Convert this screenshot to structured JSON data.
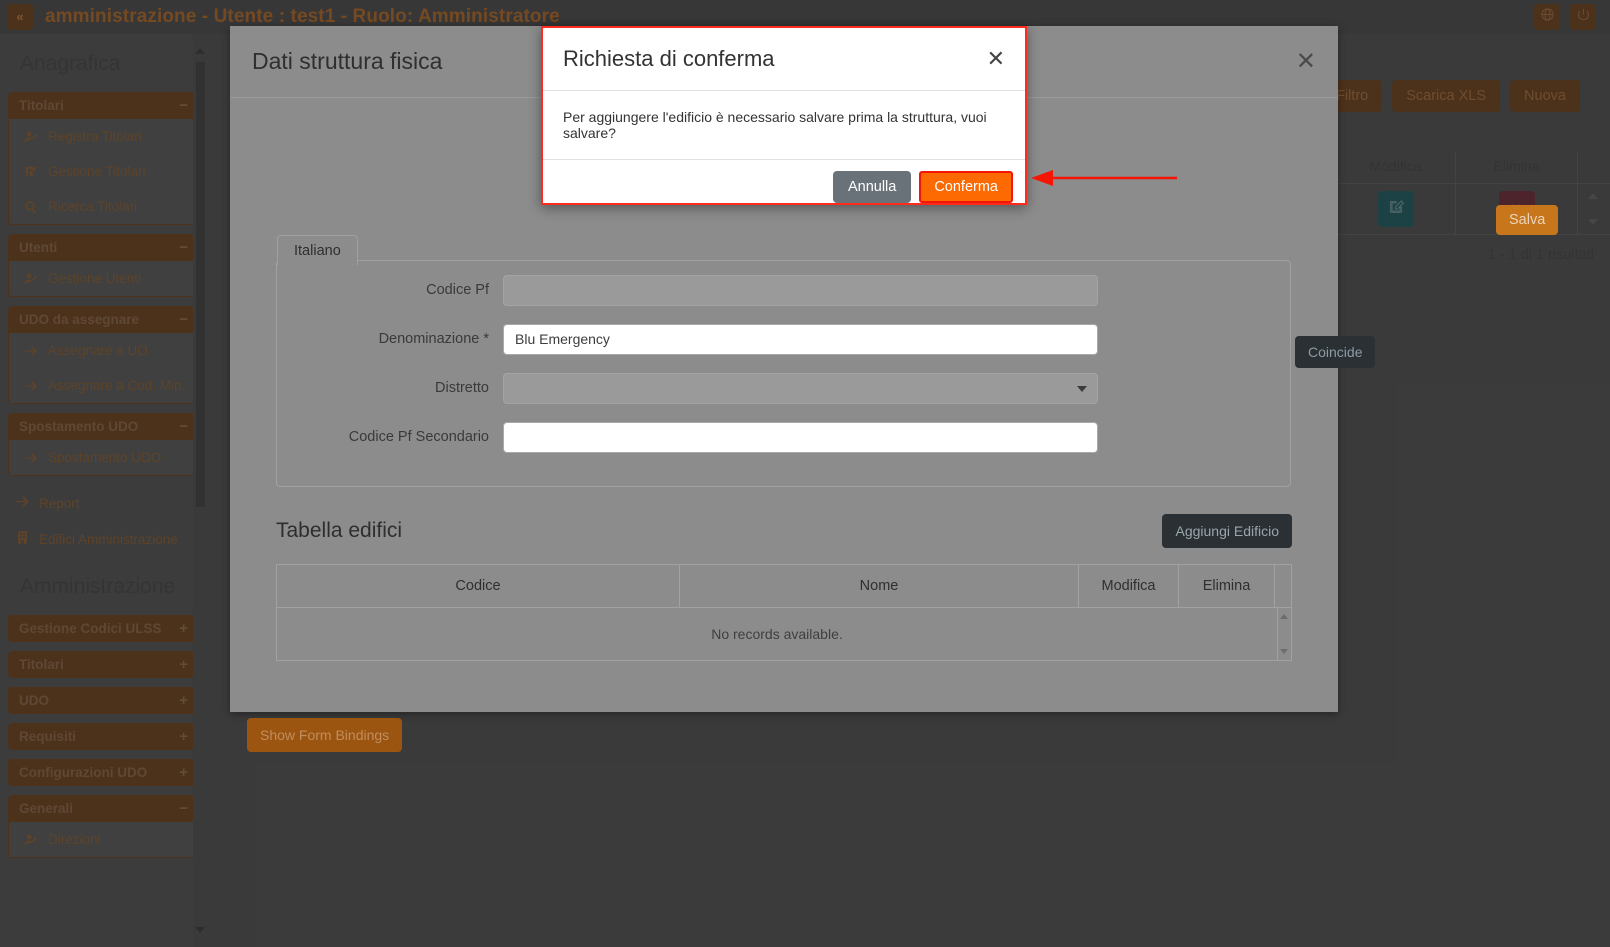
{
  "topbar": {
    "collapse_icon": "double-chevron-left-icon",
    "title": "amministrazione - Utente : test1 - Ruolo: Amministratore",
    "language_icon": "globe-icon",
    "logout_icon": "power-icon"
  },
  "sidebar": {
    "section_anagrafica": "Anagrafica",
    "section_amministrazione": "Amministrazione",
    "groups": [
      {
        "label": "Titolari",
        "sign": "−",
        "expanded": true,
        "items": [
          {
            "label": "Registra Titolari",
            "icon": "user-add-icon"
          },
          {
            "label": "Gestione Titolari",
            "icon": "edit-square-icon"
          },
          {
            "label": "Ricerca Titolari",
            "icon": "search-icon"
          }
        ]
      },
      {
        "label": "Utenti",
        "sign": "−",
        "expanded": true,
        "items": [
          {
            "label": "Gestione Utenti",
            "icon": "user-add-icon"
          }
        ]
      },
      {
        "label": "UDO da assegnare",
        "sign": "−",
        "expanded": true,
        "items": [
          {
            "label": "Assegnare a UO",
            "icon": "arrow-right-icon"
          },
          {
            "label": "Assegnare a Cod. Min.",
            "icon": "arrow-right-icon"
          }
        ]
      },
      {
        "label": "Spostamento UDO",
        "sign": "−",
        "expanded": true,
        "items": [
          {
            "label": "Spostamento UDO",
            "icon": "arrow-right-icon"
          }
        ]
      }
    ],
    "loose_items": [
      {
        "label": "Report",
        "icon": "arrow-right-icon"
      },
      {
        "label": "Edifici Amministrazione",
        "icon": "building-icon"
      }
    ],
    "admin_groups": [
      {
        "label": "Gestione Codici ULSS",
        "sign": "+",
        "expanded": false,
        "items": []
      },
      {
        "label": "Titolari",
        "sign": "+",
        "expanded": false,
        "items": []
      },
      {
        "label": "UDO",
        "sign": "+",
        "expanded": false,
        "items": []
      },
      {
        "label": "Requisiti",
        "sign": "+",
        "expanded": false,
        "items": []
      },
      {
        "label": "Configurazioni UDO",
        "sign": "+",
        "expanded": false,
        "items": []
      },
      {
        "label": "Generali",
        "sign": "−",
        "expanded": true,
        "items": [
          {
            "label": "Direzioni",
            "icon": "user-add-icon"
          }
        ]
      }
    ]
  },
  "background": {
    "buttons": [
      {
        "label": "Filtro"
      },
      {
        "label": "Scarica XLS"
      },
      {
        "label": "Nuova"
      }
    ],
    "table": {
      "headers": [
        "Modifica",
        "Elimina"
      ],
      "row": {
        "edit_icon": "edit-square-icon",
        "delete_icon": "close-x-icon"
      }
    },
    "results": "1 - 1 di 1 risultati"
  },
  "modal": {
    "title": "Dati struttura fisica",
    "close_icon": "close-x-icon",
    "save_label": "Salva",
    "legend": "Italiano",
    "fields": [
      {
        "label": "Codice Pf",
        "value": "",
        "type": "text",
        "disabled": true
      },
      {
        "label": "Denominazione *",
        "value": "Blu Emergency",
        "type": "text",
        "disabled": false
      },
      {
        "label": "Distretto",
        "value": "",
        "type": "select",
        "disabled": true
      },
      {
        "label": "Codice Pf Secondario",
        "value": "",
        "type": "text",
        "disabled": false
      }
    ],
    "coincide_label": "Coincide",
    "table_section": {
      "title": "Tabella edifici",
      "add_label": "Aggiungi Edificio",
      "headers": [
        "Codice",
        "Nome",
        "Modifica",
        "Elimina"
      ],
      "empty_text": "No records available."
    },
    "show_bindings_label": "Show Form Bindings"
  },
  "confirm_dialog": {
    "title": "Richiesta di conferma",
    "close_icon": "close-x-icon",
    "message": "Per aggiungere l'edificio è necessario salvare prima la struttura, vuoi salvare?",
    "cancel_label": "Annulla",
    "confirm_label": "Conferma"
  },
  "annotation": {
    "arrow_color": "#f51505",
    "target": "Conferma"
  },
  "colors": {
    "brand_brown": "#6b3b12",
    "accent_orange": "#fd6a02",
    "highlight_red": "#f51505",
    "save_orange": "#c8761b"
  }
}
